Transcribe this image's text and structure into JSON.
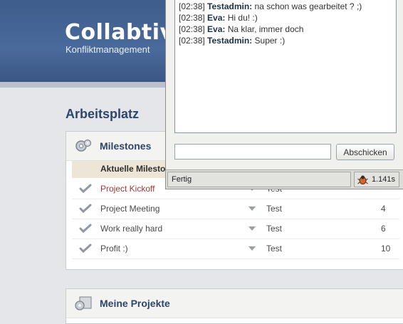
{
  "header": {
    "app_title": "Collabtive",
    "subtitle": "Konfliktmanagement"
  },
  "main": {
    "section_title": "Arbeitsplatz",
    "milestones": {
      "title": "Milestones",
      "column_header": "Aktuelle Milestones",
      "rows": [
        {
          "name": "Project Kickoff",
          "project": "Test",
          "days": "",
          "late": true
        },
        {
          "name": "Project Meeting",
          "project": "Test",
          "days": "4",
          "late": false
        },
        {
          "name": "Work really hard",
          "project": "Test",
          "days": "6",
          "late": false
        },
        {
          "name": "Profit :)",
          "project": "Test",
          "days": "10",
          "late": false
        }
      ]
    },
    "projects": {
      "title": "Meine Projekte"
    }
  },
  "chat": {
    "messages": [
      {
        "time": "[02:38]",
        "user": "Testadmin:",
        "text": "na schon was gearbeitet ? ;)"
      },
      {
        "time": "[02:38]",
        "user": "Eva:",
        "text": "Hi du! :)"
      },
      {
        "time": "[02:38]",
        "user": "Eva:",
        "text": "Na klar, immer doch"
      },
      {
        "time": "[02:38]",
        "user": "Testadmin:",
        "text": "Super :)"
      }
    ],
    "input_value": "",
    "send_label": "Abschicken",
    "status_text": "Fertig",
    "load_time": "1.141s"
  },
  "icons": {
    "gear": "gear-icon",
    "check": "check-icon",
    "dropdown": "triangle-down-icon",
    "firebug": "firebug-icon"
  },
  "colors": {
    "header_blue": "#4a6a9c",
    "title_blue": "#2f4668",
    "late_red": "#a13a35"
  }
}
